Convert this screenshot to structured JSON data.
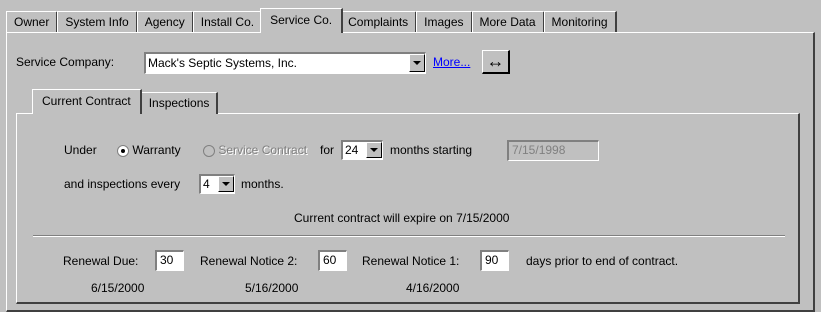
{
  "outer_tabs": [
    {
      "label": "Owner",
      "key": "O"
    },
    {
      "label": "System Info",
      "key": "S"
    },
    {
      "label": "Agency",
      "key": "A"
    },
    {
      "label": "Install Co.",
      "key": "I"
    },
    {
      "label": "Service Co.",
      "key": "S"
    },
    {
      "label": "Complaints",
      "key": ""
    },
    {
      "label": "Images",
      "key": "I"
    },
    {
      "label": "More Data",
      "key": "M"
    },
    {
      "label": "Monitoring",
      "key": "M"
    }
  ],
  "active_outer_tab": "Service Co.",
  "service_company": {
    "label": "Service Company:",
    "value": "Mack's Septic Systems, Inc.",
    "more_link": "More...",
    "swap_button": "↔"
  },
  "inner_tabs": [
    {
      "label": "Current Contract",
      "key": "C"
    },
    {
      "label": "Inspections",
      "key": "I"
    }
  ],
  "active_inner_tab": "Current Contract",
  "contract": {
    "under_label": "Under",
    "warranty_label": "Warranty",
    "warranty_checked": true,
    "service_contract_label": "Service Contract",
    "service_contract_enabled": false,
    "for_label": "for",
    "months_value": "24",
    "months_starting_label": "months starting",
    "start_date": "7/15/1998",
    "inspections_label": "and inspections every",
    "inspection_interval": "4",
    "months_label": "months.",
    "expire_text": "Current contract will expire on 7/15/2000"
  },
  "renewal": {
    "due_label": "Renewal Due:",
    "due_value": "30",
    "due_date": "6/15/2000",
    "notice2_label": "Renewal Notice 2:",
    "notice2_value": "60",
    "notice2_date": "5/16/2000",
    "notice1_label": "Renewal Notice 1:",
    "notice1_value": "90",
    "notice1_date": "4/16/2000",
    "suffix": "days prior to end of contract."
  }
}
